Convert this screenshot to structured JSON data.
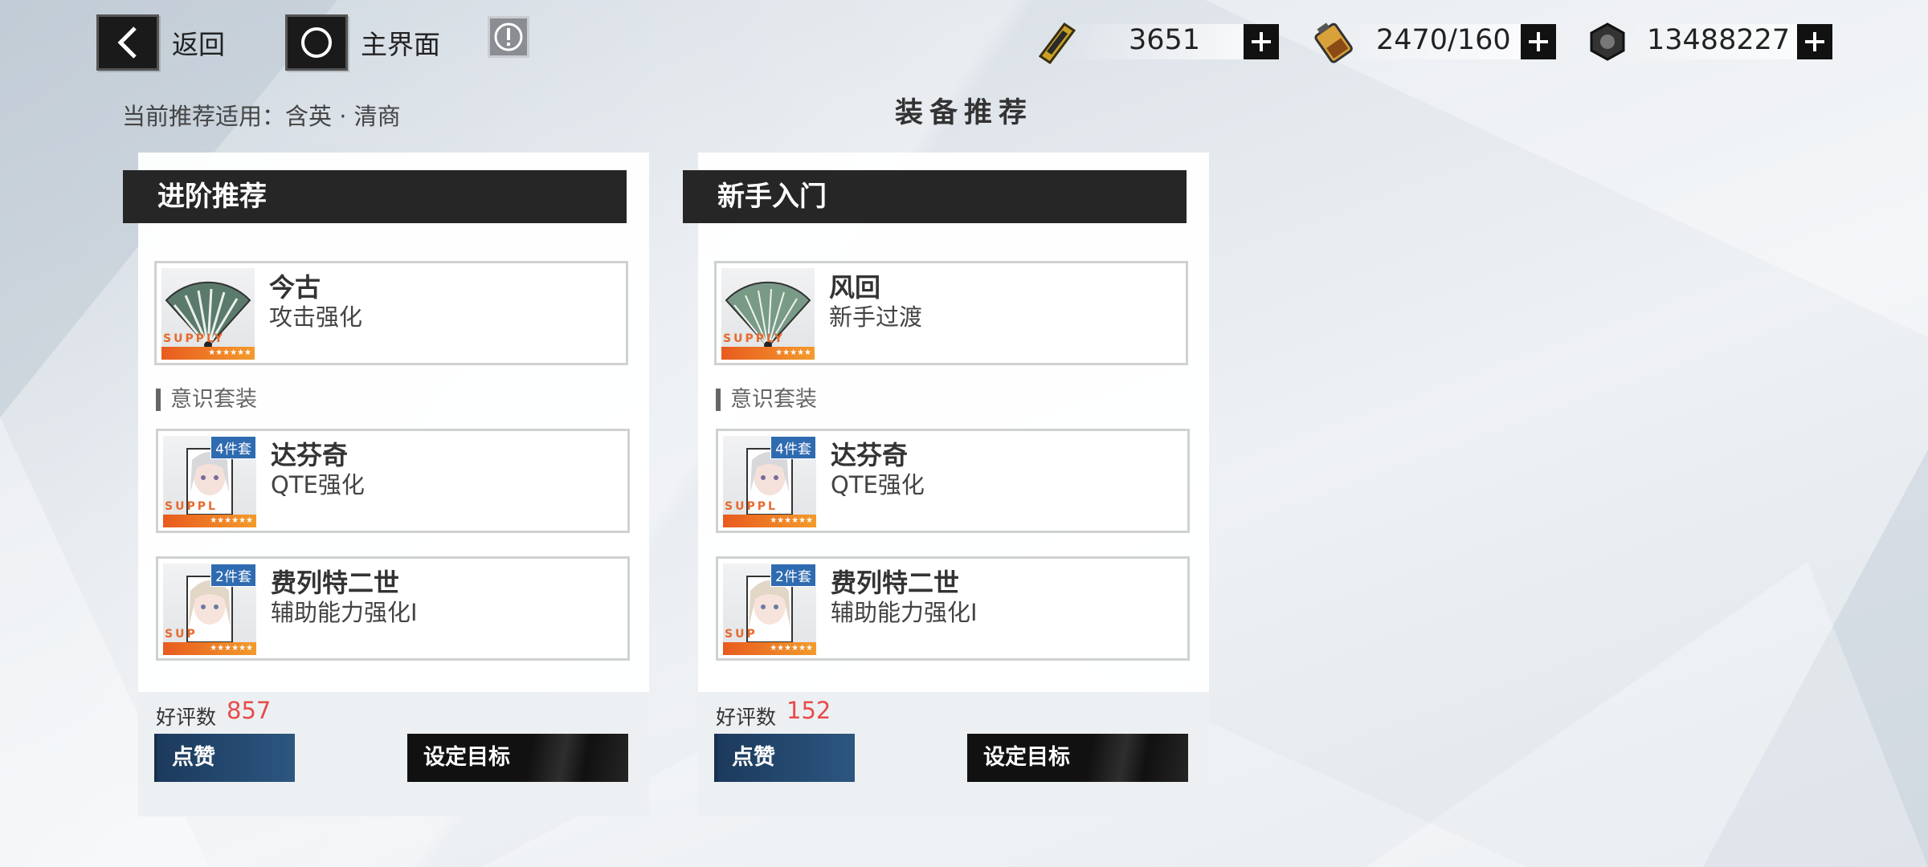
{
  "nav": {
    "back_label": "返回",
    "home_label": "主界面",
    "alert_icon": "alert-icon"
  },
  "resources": [
    {
      "name": "ticket",
      "icon": "ticket-icon",
      "value": "3651"
    },
    {
      "name": "stamina",
      "icon": "stamina-battery-icon",
      "value": "2470/160"
    },
    {
      "name": "coins",
      "icon": "coin-icon",
      "value": "13488227"
    }
  ],
  "header": {
    "subtitle": "当前推荐适用：含英 · 清商",
    "title": "装备推荐"
  },
  "cards": [
    {
      "title": "进阶推荐",
      "weapon": {
        "name": "今古",
        "desc": "攻击强化",
        "supply": "SUPPLY",
        "stars": "★★★★★★"
      },
      "section_label": "意识套装",
      "sets": [
        {
          "name": "达芬奇",
          "desc": "QTE强化",
          "badge": "4件套",
          "supply": "SUPPL",
          "stars": "★★★★★★"
        },
        {
          "name": "费列特二世",
          "desc": "辅助能力强化Ⅰ",
          "badge": "2件套",
          "supply": "SUP",
          "stars": "★★★★★★"
        }
      ],
      "likes_label": "好评数",
      "likes": "857",
      "like_button": "点赞",
      "goal_button": "设定目标"
    },
    {
      "title": "新手入门",
      "weapon": {
        "name": "风回",
        "desc": "新手过渡",
        "supply": "SUPPLY",
        "stars": "★★★★★"
      },
      "section_label": "意识套装",
      "sets": [
        {
          "name": "达芬奇",
          "desc": "QTE强化",
          "badge": "4件套",
          "supply": "SUPPL",
          "stars": "★★★★★★"
        },
        {
          "name": "费列特二世",
          "desc": "辅助能力强化Ⅰ",
          "badge": "2件套",
          "supply": "SUP",
          "stars": "★★★★★★"
        }
      ],
      "likes_label": "好评数",
      "likes": "152",
      "like_button": "点赞",
      "goal_button": "设定目标"
    }
  ]
}
